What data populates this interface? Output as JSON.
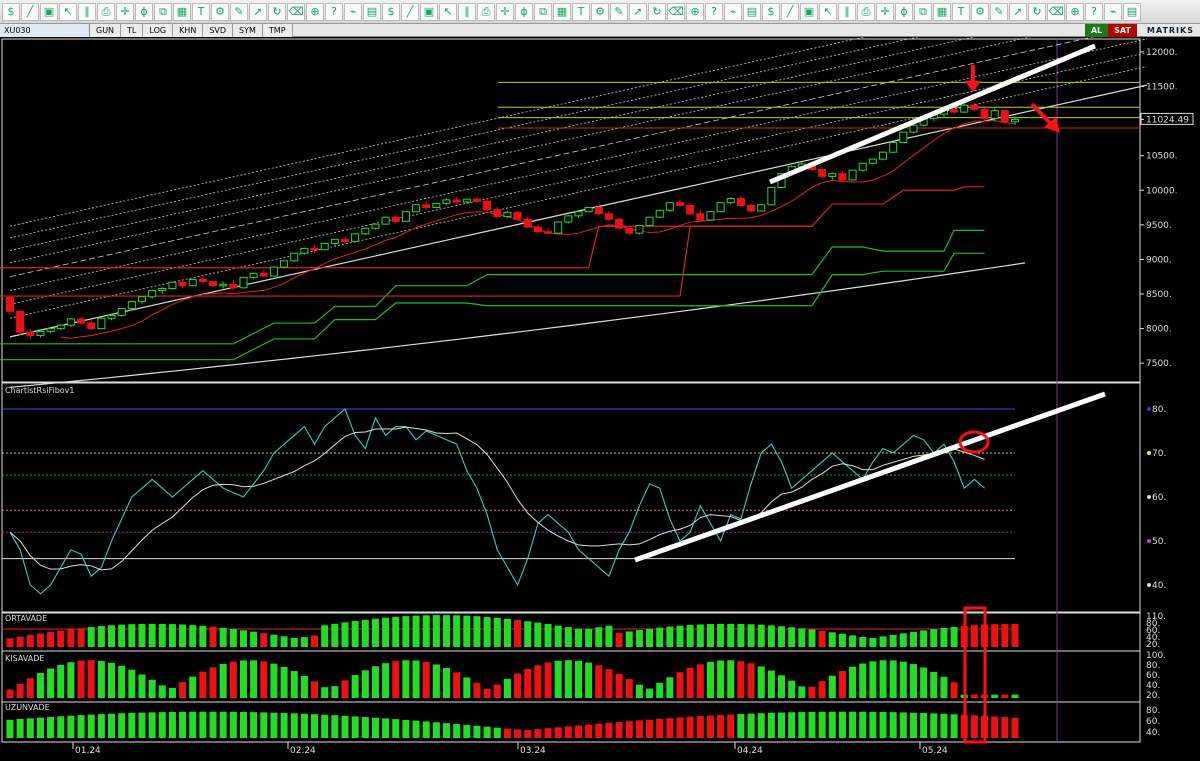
{
  "toolbar": {
    "icons": [
      "dollar-icon",
      "cursor-icon",
      "crosshair-icon",
      "grid-icon",
      "tools-icon",
      "eraser-icon",
      "magnet-icon",
      "line-icon",
      "channel-icon",
      "fib-icon",
      "text-icon",
      "arrow-icon",
      "zoom-icon",
      "chart-icon",
      "save-icon",
      "print-icon",
      "copy-icon",
      "settings-icon",
      "refresh-icon",
      "help-icon"
    ]
  },
  "tabbar": {
    "symbol": "XU030",
    "tabs": [
      "GUN",
      "TL",
      "LOG",
      "KHN",
      "SVD",
      "SYM",
      "TMP"
    ],
    "buy_label": "AL",
    "sell_label": "SAT",
    "brand": "MATRIKS"
  },
  "colors": {
    "bull": "#22dd22",
    "bear": "#ee1111",
    "grid_border": "#ffffff",
    "accent_red": "#ff1010"
  },
  "price_axis": {
    "ticks": [
      "12000.",
      "11500.",
      "11024.49",
      "10500.",
      "10000.",
      "9500.",
      "9000.",
      "8500.",
      "8000.",
      "7500."
    ],
    "current": "11024.49"
  },
  "rsi_pane": {
    "label": "ChartistRsiFibov1",
    "ticks": [
      "80.",
      "70.",
      "60.",
      "50.",
      "40."
    ]
  },
  "ortavade_pane": {
    "label": "ORTAVADE",
    "ticks": [
      "110.",
      "80.",
      "60.",
      "40.",
      "20."
    ]
  },
  "kisavade_pane": {
    "label": "KISAVADE",
    "ticks": [
      "100.",
      "80.",
      "60.",
      "40.",
      "20."
    ]
  },
  "uzunvade_pane": {
    "label": "UZUNVADE",
    "ticks": [
      "80.",
      "60.",
      "40."
    ]
  },
  "time_axis": {
    "ticks": [
      "01.24",
      "02.24",
      "03.24",
      "04.24",
      "05.24"
    ]
  },
  "chart_data": {
    "type": "candlestick",
    "symbol": "XU030",
    "price_range": [
      7300,
      12100
    ],
    "candles": [
      [
        8450,
        8480,
        8200,
        8250
      ],
      [
        8250,
        8280,
        7900,
        7950
      ],
      [
        7950,
        8000,
        7850,
        7900
      ],
      [
        7900,
        7980,
        7870,
        7960
      ],
      [
        7960,
        8020,
        7930,
        8000
      ],
      [
        8000,
        8060,
        7980,
        8050
      ],
      [
        8050,
        8150,
        8020,
        8140
      ],
      [
        8140,
        8170,
        8060,
        8080
      ],
      [
        8080,
        8120,
        7980,
        8000
      ],
      [
        8000,
        8160,
        7990,
        8150
      ],
      [
        8150,
        8210,
        8120,
        8190
      ],
      [
        8190,
        8300,
        8170,
        8290
      ],
      [
        8290,
        8400,
        8270,
        8390
      ],
      [
        8390,
        8470,
        8350,
        8460
      ],
      [
        8460,
        8560,
        8430,
        8550
      ],
      [
        8550,
        8600,
        8500,
        8580
      ],
      [
        8580,
        8680,
        8560,
        8670
      ],
      [
        8670,
        8700,
        8580,
        8620
      ],
      [
        8620,
        8720,
        8610,
        8710
      ],
      [
        8710,
        8760,
        8650,
        8680
      ],
      [
        8680,
        8700,
        8600,
        8620
      ],
      [
        8620,
        8680,
        8580,
        8640
      ],
      [
        8640,
        8700,
        8560,
        8590
      ],
      [
        8590,
        8750,
        8580,
        8740
      ],
      [
        8740,
        8810,
        8720,
        8800
      ],
      [
        8800,
        8850,
        8740,
        8760
      ],
      [
        8760,
        8900,
        8750,
        8890
      ],
      [
        8890,
        8990,
        8870,
        8980
      ],
      [
        8980,
        9100,
        8960,
        9090
      ],
      [
        9090,
        9170,
        9070,
        9160
      ],
      [
        9160,
        9200,
        9100,
        9140
      ],
      [
        9140,
        9240,
        9130,
        9230
      ],
      [
        9230,
        9300,
        9200,
        9290
      ],
      [
        9290,
        9330,
        9230,
        9260
      ],
      [
        9260,
        9380,
        9250,
        9370
      ],
      [
        9370,
        9460,
        9350,
        9450
      ],
      [
        9450,
        9520,
        9430,
        9510
      ],
      [
        9510,
        9620,
        9500,
        9610
      ],
      [
        9610,
        9650,
        9520,
        9550
      ],
      [
        9550,
        9700,
        9540,
        9690
      ],
      [
        9690,
        9800,
        9680,
        9790
      ],
      [
        9790,
        9840,
        9720,
        9750
      ],
      [
        9750,
        9820,
        9740,
        9810
      ],
      [
        9810,
        9880,
        9790,
        9860
      ],
      [
        9860,
        9900,
        9800,
        9830
      ],
      [
        9830,
        9880,
        9810,
        9870
      ],
      [
        9870,
        9900,
        9820,
        9840
      ],
      [
        9840,
        9880,
        9700,
        9720
      ],
      [
        9720,
        9760,
        9600,
        9620
      ],
      [
        9620,
        9700,
        9600,
        9680
      ],
      [
        9680,
        9700,
        9560,
        9580
      ],
      [
        9580,
        9620,
        9450,
        9470
      ],
      [
        9470,
        9500,
        9380,
        9400
      ],
      [
        9400,
        9450,
        9360,
        9380
      ],
      [
        9380,
        9550,
        9370,
        9540
      ],
      [
        9540,
        9640,
        9520,
        9630
      ],
      [
        9630,
        9700,
        9600,
        9690
      ],
      [
        9690,
        9760,
        9680,
        9750
      ],
      [
        9750,
        9780,
        9640,
        9660
      ],
      [
        9660,
        9700,
        9560,
        9580
      ],
      [
        9580,
        9600,
        9430,
        9450
      ],
      [
        9450,
        9480,
        9360,
        9380
      ],
      [
        9380,
        9500,
        9360,
        9490
      ],
      [
        9490,
        9620,
        9480,
        9610
      ],
      [
        9610,
        9720,
        9600,
        9710
      ],
      [
        9710,
        9830,
        9690,
        9820
      ],
      [
        9820,
        9870,
        9760,
        9780
      ],
      [
        9780,
        9810,
        9640,
        9660
      ],
      [
        9660,
        9720,
        9550,
        9570
      ],
      [
        9570,
        9700,
        9560,
        9690
      ],
      [
        9690,
        9830,
        9680,
        9820
      ],
      [
        9820,
        9900,
        9800,
        9880
      ],
      [
        9880,
        9920,
        9760,
        9780
      ],
      [
        9780,
        9800,
        9680,
        9700
      ],
      [
        9700,
        9800,
        9690,
        9790
      ],
      [
        9790,
        10050,
        9780,
        10040
      ],
      [
        10040,
        10250,
        10030,
        10240
      ],
      [
        10240,
        10360,
        10220,
        10340
      ],
      [
        10340,
        10400,
        10300,
        10380
      ],
      [
        10380,
        10420,
        10280,
        10300
      ],
      [
        10300,
        10340,
        10180,
        10200
      ],
      [
        10200,
        10260,
        10150,
        10240
      ],
      [
        10240,
        10280,
        10130,
        10150
      ],
      [
        10150,
        10300,
        10140,
        10290
      ],
      [
        10290,
        10400,
        10270,
        10390
      ],
      [
        10390,
        10460,
        10370,
        10450
      ],
      [
        10450,
        10560,
        10430,
        10550
      ],
      [
        10550,
        10700,
        10540,
        10690
      ],
      [
        10690,
        10850,
        10680,
        10840
      ],
      [
        10840,
        10950,
        10820,
        10940
      ],
      [
        10940,
        11050,
        10920,
        11040
      ],
      [
        11040,
        11120,
        11000,
        11100
      ],
      [
        11100,
        11180,
        11060,
        11160
      ],
      [
        11160,
        11200,
        11100,
        11130
      ],
      [
        11130,
        11250,
        11120,
        11230
      ],
      [
        11230,
        11270,
        11140,
        11170
      ],
      [
        11170,
        11190,
        11020,
        11040
      ],
      [
        11040,
        11180,
        11000,
        11150
      ],
      [
        11150,
        11160,
        10960,
        10990
      ],
      [
        10990,
        11060,
        10950,
        11024
      ]
    ],
    "rsi_range": [
      35,
      85
    ]
  }
}
